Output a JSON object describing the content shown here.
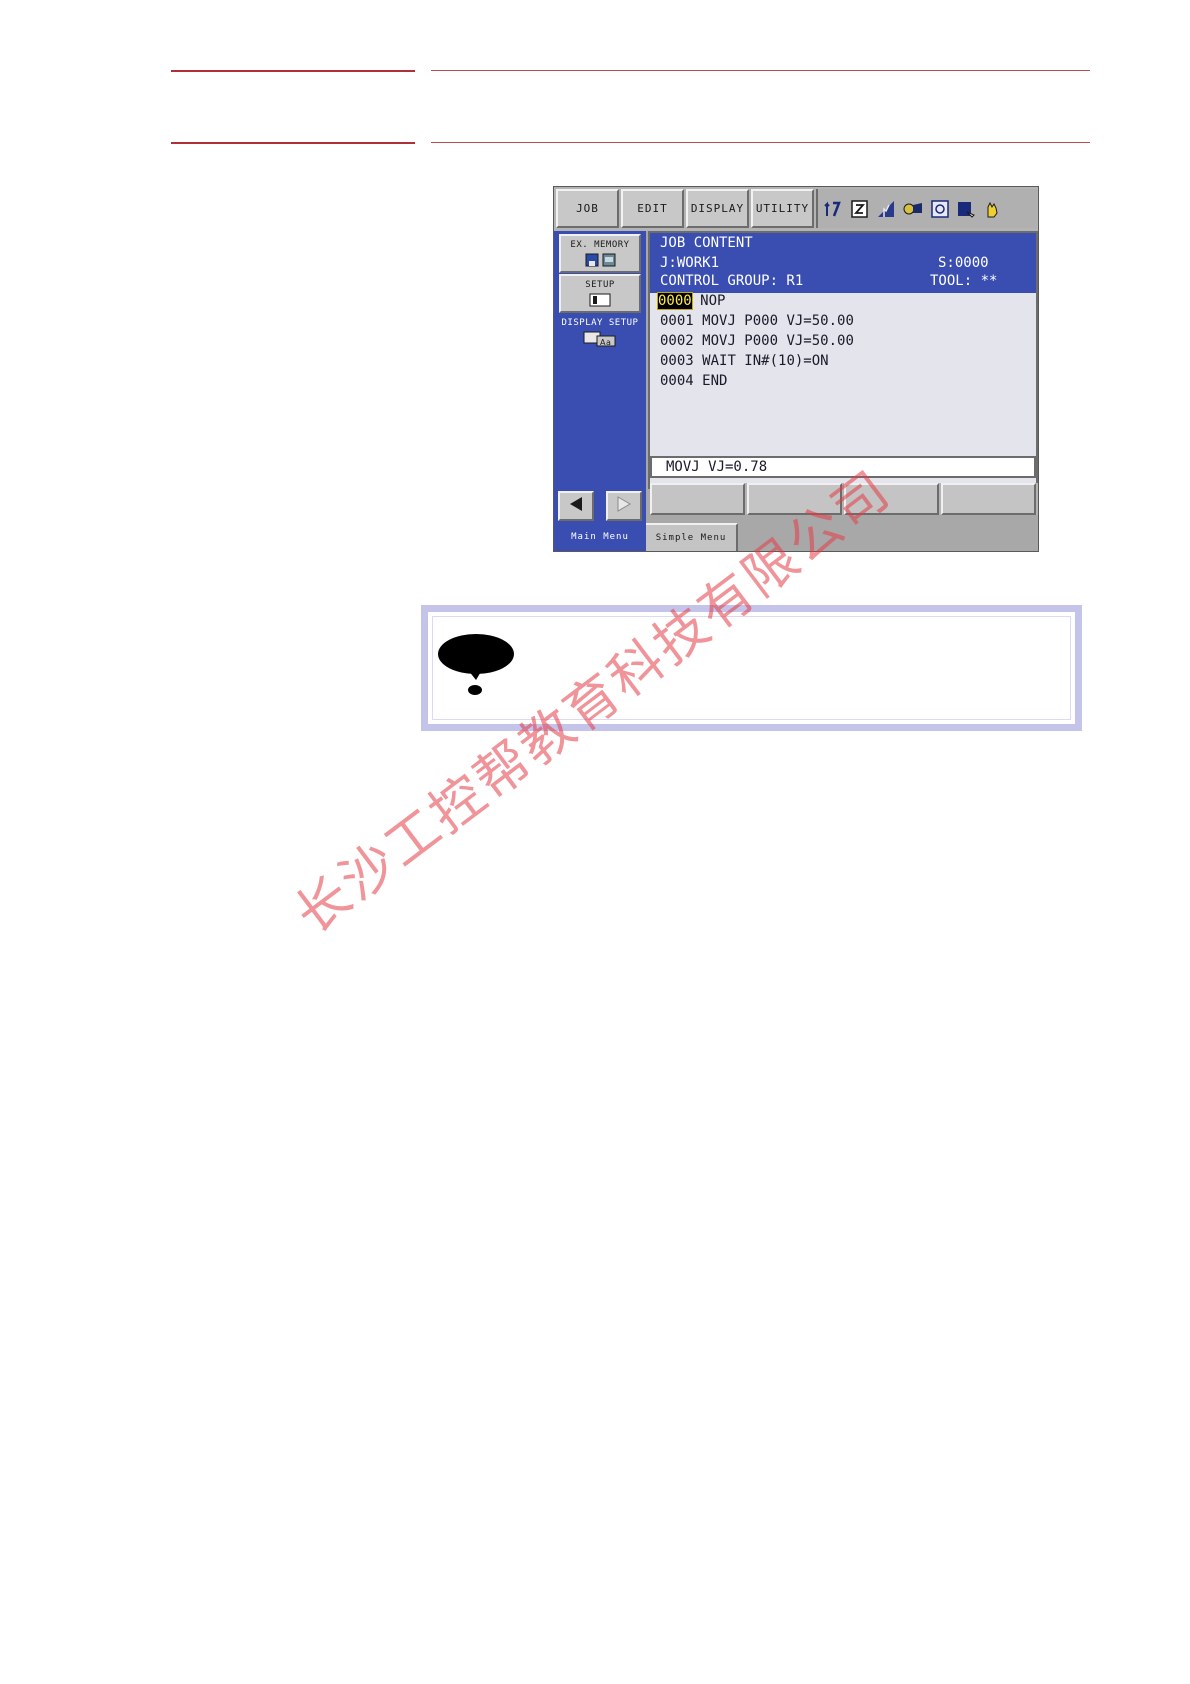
{
  "pendant": {
    "menu_tabs": [
      "JOB",
      "EDIT",
      "DISPLAY",
      "UTILITY"
    ],
    "status_icons": [
      "teach-mode-icon",
      "edit-icon",
      "signal-icon",
      "robot-group-icon",
      "coordinate-icon",
      "security-icon",
      "hand-icon"
    ],
    "side_buttons": {
      "ex_memory": "EX. MEMORY",
      "setup": "SETUP",
      "display_setup": "DISPLAY SETUP"
    },
    "content": {
      "title": "JOB CONTENT",
      "job": "J:WORK1",
      "step": "S:0000",
      "control_group": "CONTROL GROUP: R1",
      "tool": "TOOL: **",
      "lines": [
        {
          "no": "0000",
          "text": "NOP"
        },
        {
          "no": "0001",
          "text": "MOVJ P000 VJ=50.00"
        },
        {
          "no": "0002",
          "text": "MOVJ P000 VJ=50.00"
        },
        {
          "no": "0003",
          "text": "WAIT IN#(10)=ON"
        },
        {
          "no": "0004",
          "text": "END"
        }
      ],
      "cursor_line": "0000"
    },
    "input_line": "MOVJ VJ=0.78",
    "bottom_tabs": {
      "main_menu": "Main Menu",
      "simple_menu": "Simple Menu"
    }
  },
  "watermark": "长沙工控帮教育科技有限公司",
  "colors": {
    "screen_blue": "#3a4eb2",
    "panel_gray": "#c8c8c8",
    "cursor_text": "#ffe94a",
    "rule_red": "#b0303a",
    "note_border": "#c4c4ea",
    "watermark": "#e63c46"
  }
}
